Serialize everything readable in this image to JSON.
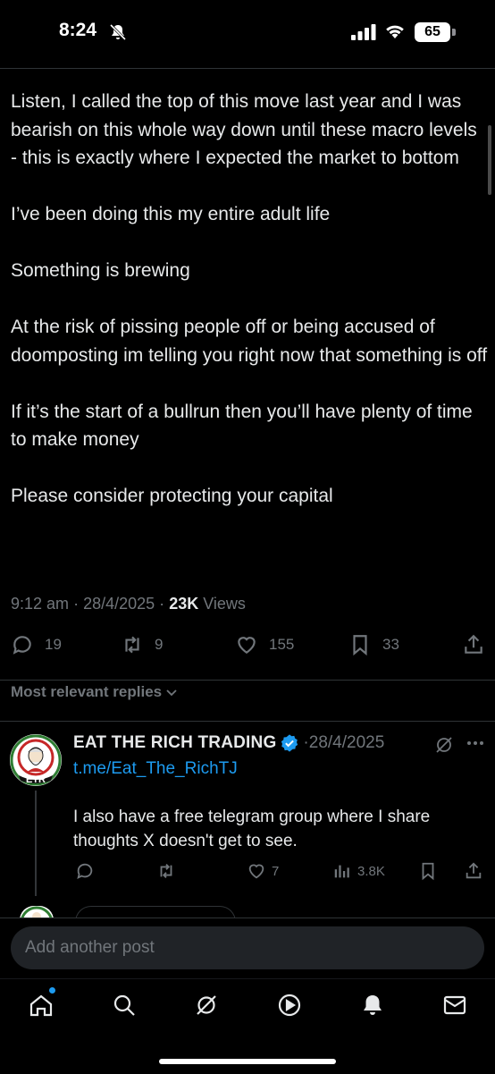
{
  "status_bar": {
    "time": "8:24",
    "battery": "65"
  },
  "post": {
    "paragraphs": [
      "Listen, I called the top of this move last year and I was bearish on this whole way down until these macro levels - this is exactly where I expected the market to bottom",
      "I’ve been doing this my entire adult life",
      "Something is brewing",
      "At the risk of pissing people off or being accused of doomposting im telling you right now that something is off",
      "If it’s the start of a bullrun then you’ll have plenty of time to make money",
      "Please consider protecting your capital"
    ],
    "time": "9:12 am",
    "date": "28/4/2025",
    "views_count": "23K",
    "views_label": "Views",
    "sep": "·",
    "actions": {
      "replies": "19",
      "reposts": "9",
      "likes": "155",
      "bookmarks": "33"
    }
  },
  "replies_sort": {
    "label": "Most relevant replies"
  },
  "reply": {
    "name": "EAT THE RICH TRADING",
    "sep": "·",
    "date": "28/4/2025",
    "link": "t.me/Eat_The_RichTJ",
    "text": "I also have a free telegram group where I share thoughts X doesn't get to see.",
    "avatar_text": "ETR",
    "actions": {
      "likes": "7",
      "views": "3.8K"
    }
  },
  "compose": {
    "placeholder": "Add another post"
  },
  "colors": {
    "accent": "#1d9bf0",
    "muted": "#71767b",
    "text": "#e7e9ea",
    "background": "#000000"
  },
  "icons": [
    "bell-slash-icon",
    "signal-icon",
    "wifi-icon",
    "reply-icon",
    "repost-icon",
    "like-icon",
    "bookmark-icon",
    "share-icon",
    "verified-icon",
    "grok-icon",
    "more-icon",
    "views-icon",
    "home-icon",
    "search-icon",
    "grok-tab-icon",
    "video-icon",
    "notifications-icon",
    "messages-icon"
  ]
}
